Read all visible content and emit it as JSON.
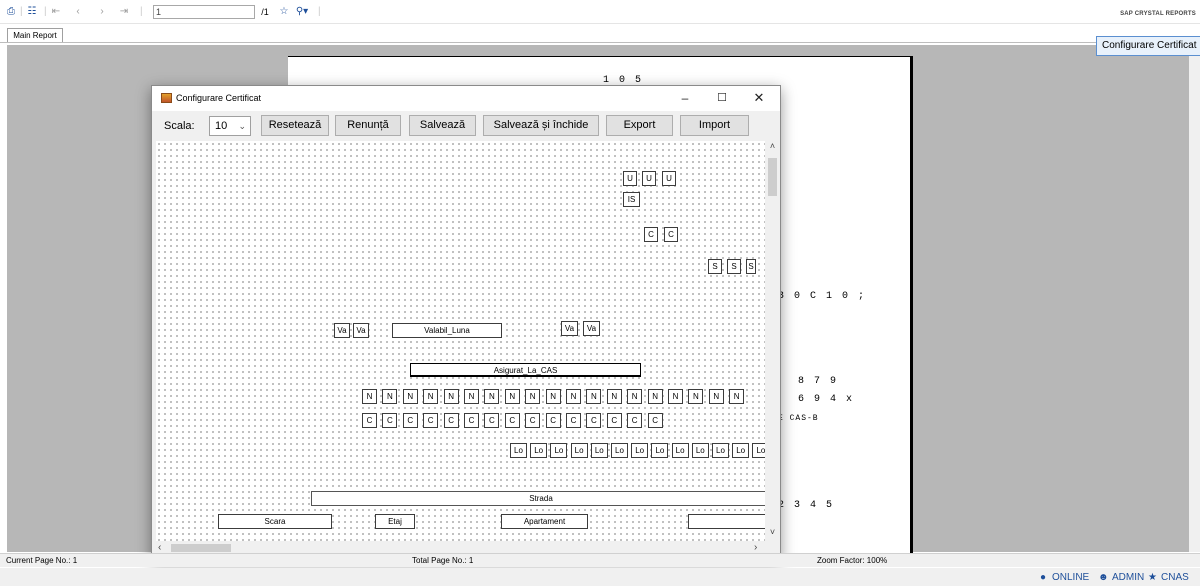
{
  "toolbar": {
    "page_input": "1",
    "page_total": "/1",
    "brand": "SAP CRYSTAL REPORTS",
    "tab_main_report": "Main Report",
    "configure_button": "Configurare Certificat"
  },
  "report_page": {
    "lines": [
      {
        "text": "1 0 5"
      },
      {
        "text": "3 0     C 1 0 ;"
      },
      {
        "text": "8 7 9"
      },
      {
        "text": "6 9 4  x"
      },
      {
        "text": "E   CAS-B"
      },
      {
        "text": "2 3 4 5"
      }
    ]
  },
  "status": {
    "current_page": "Current Page No.: 1",
    "total_page": "Total Page No.: 1",
    "zoom": "Zoom Factor: 100%",
    "online": "ONLINE",
    "user": "ADMIN",
    "cnas": "CNAS"
  },
  "dialog": {
    "title": "Configurare Certificat",
    "scala_label": "Scala:",
    "scala_value": "10",
    "buttons": {
      "reset": "Resetează",
      "cancel": "Renunță",
      "save": "Salvează",
      "save_close": "Salvează și închide",
      "export": "Export",
      "import": "Import"
    },
    "fields": {
      "u": "U",
      "is": "IS",
      "c": "C",
      "s": "S",
      "va": "Va",
      "valabil_luna": "Valabil_Luna",
      "asigurat_la_cas": "Asigurat_La_CAS",
      "n": "N",
      "lo": "Lo",
      "strada": "Strada",
      "scara": "Scara",
      "etaj": "Etaj",
      "apartament": "Apartament"
    }
  },
  "icons": {
    "print": "print-icon",
    "tree": "group-tree-icon",
    "first": "first-page-icon",
    "prev": "previous-page-icon",
    "next": "next-page-icon",
    "last": "last-page-icon",
    "find": "binoculars-icon",
    "zoom": "zoom-icon",
    "online": "globe-icon",
    "user": "user-icon",
    "cnas": "cnas-icon"
  }
}
